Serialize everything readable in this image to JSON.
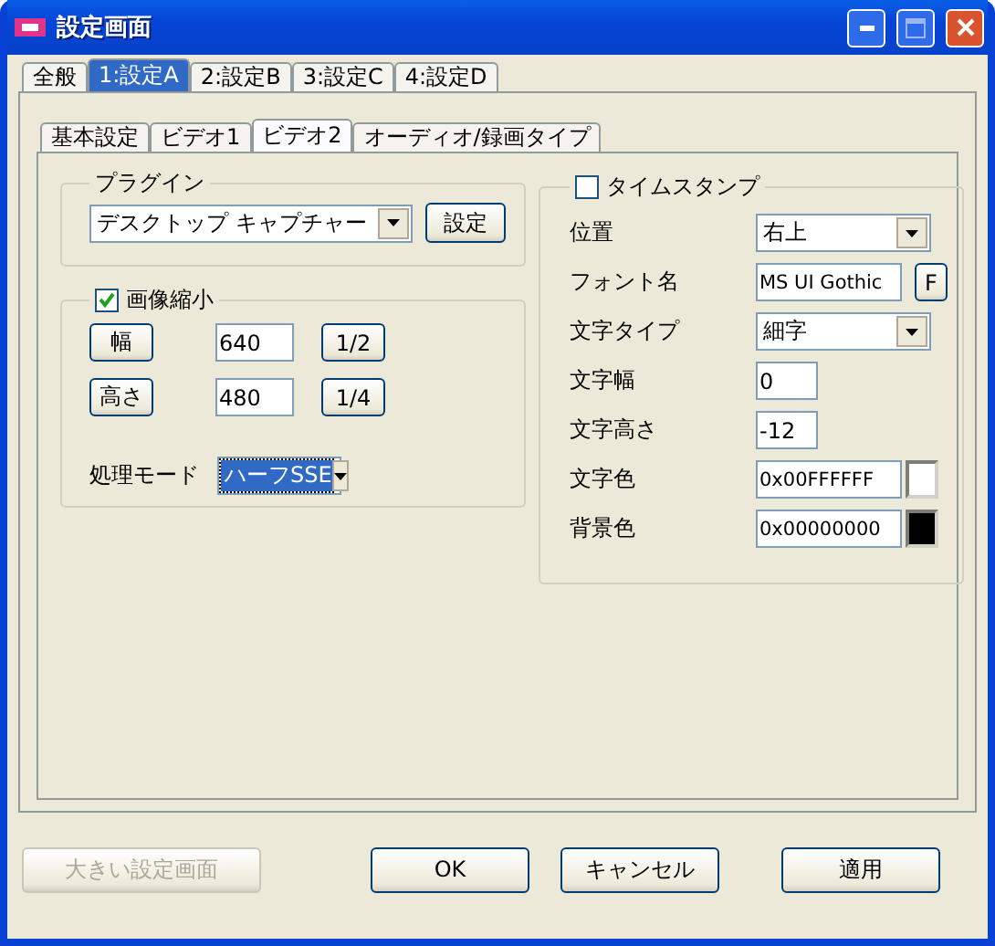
{
  "window": {
    "title": "設定画面"
  },
  "tabs": [
    {
      "label": "全般",
      "selected": false
    },
    {
      "label": "1:設定A",
      "selected": true
    },
    {
      "label": "2:設定B",
      "selected": false
    },
    {
      "label": "3:設定C",
      "selected": false
    },
    {
      "label": "4:設定D",
      "selected": false
    }
  ],
  "sub_tabs": [
    {
      "label": "基本設定",
      "selected": false
    },
    {
      "label": "ビデオ1",
      "selected": false
    },
    {
      "label": "ビデオ2",
      "selected": true
    },
    {
      "label": "オーディオ/録画タイプ",
      "selected": false
    }
  ],
  "plugin": {
    "legend": "プラグイン",
    "value": "デスクトップ キャプチャー",
    "button": "設定"
  },
  "resize": {
    "label": "画像縮小",
    "checked": true,
    "rows": [
      {
        "button": "幅",
        "value": "640",
        "ratio": "1/2"
      },
      {
        "button": "高さ",
        "value": "480",
        "ratio": "1/4"
      }
    ],
    "mode": {
      "label": "処理モード",
      "value": "ハーフSSE"
    }
  },
  "timestamp": {
    "label": "タイムスタンプ",
    "checked": false,
    "rows": [
      {
        "kind": "select",
        "label": "位置",
        "value": "右上"
      },
      {
        "kind": "font",
        "label": "フォント名",
        "value": "MS UI Gothic",
        "button": "F"
      },
      {
        "kind": "select",
        "label": "文字タイプ",
        "value": "細字"
      },
      {
        "kind": "text",
        "label": "文字幅",
        "value": "0"
      },
      {
        "kind": "text",
        "label": "文字高さ",
        "value": "-12"
      },
      {
        "kind": "color",
        "label": "文字色",
        "value": "0x00FFFFFF",
        "color": "#ffffff"
      },
      {
        "kind": "color",
        "label": "背景色",
        "value": "0x00000000",
        "color": "#000000"
      }
    ]
  },
  "buttons": [
    {
      "label": "大きい設定画面",
      "disabled": true
    },
    {
      "label": "OK",
      "disabled": false
    },
    {
      "label": "キャンセル",
      "disabled": false
    },
    {
      "label": "適用",
      "disabled": false
    }
  ]
}
